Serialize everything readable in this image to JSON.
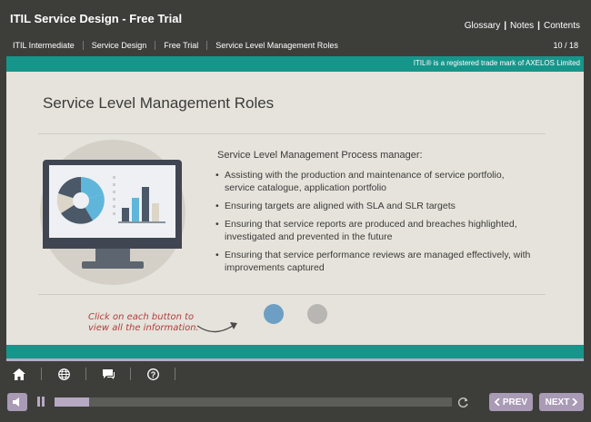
{
  "header": {
    "course_title": "ITIL Service Design - Free Trial",
    "links": [
      "Glossary",
      "Notes",
      "Contents"
    ],
    "breadcrumb": [
      "ITIL Intermediate",
      "Service Design",
      "Free Trial",
      "Service Level Management Roles"
    ],
    "page_counter": "10 / 18"
  },
  "slide": {
    "trademark": "ITIL® is a registered trade mark of AXELOS Limited",
    "title": "Service Level Management Roles",
    "content_heading": "Service Level Management Process manager:",
    "bullets": [
      "Assisting with the production and maintenance of service portfolio, service catalogue, application portfolio",
      "Ensuring targets are aligned with SLA and SLR targets",
      "Ensuring that service reports are produced and breaches highlighted, investigated and prevented in the future",
      "Ensuring that service performance reviews are managed effectively, with improvements captured"
    ],
    "hint_line1": "Click on each button to",
    "hint_line2": "view all the information.",
    "illustration_icon": "monitor-with-charts",
    "buttons": [
      {
        "color": "#6d9fc4"
      },
      {
        "color": "#b7b6b2"
      }
    ]
  },
  "toolbar": {
    "icons": [
      "home-icon",
      "globe-icon",
      "chat-icon",
      "help-icon"
    ]
  },
  "player": {
    "progress": 0.087,
    "prev_label": "PREV",
    "next_label": "NEXT"
  },
  "colors": {
    "background": "#3d3e3a",
    "teal": "#16968a",
    "accent_purple": "#a99bb5",
    "slide_bg": "#e5e3db",
    "hint_red": "#b43c3c"
  }
}
